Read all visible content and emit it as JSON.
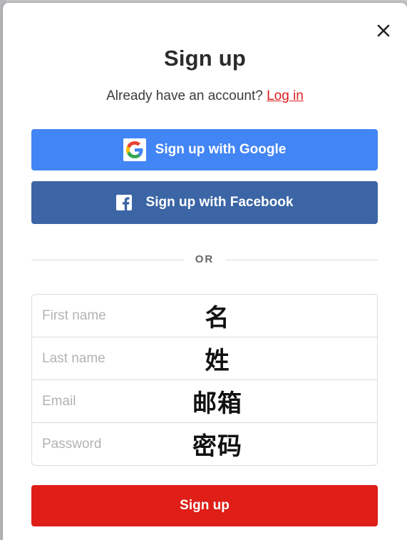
{
  "modal": {
    "title": "Sign up",
    "subtitle_prefix": "Already have an account?",
    "login_link": "Log in",
    "close_icon": "close-icon"
  },
  "social": {
    "google_label": "Sign up with Google",
    "google_icon": "google-g-icon",
    "google_color": "#4285f4",
    "facebook_label": "Sign up with Facebook",
    "facebook_icon": "facebook-f-icon",
    "facebook_color": "#3b65a5"
  },
  "divider": {
    "label": "OR"
  },
  "form": {
    "fields": [
      {
        "placeholder": "First name",
        "annotation": "名"
      },
      {
        "placeholder": "Last name",
        "annotation": "姓"
      },
      {
        "placeholder": "Email",
        "annotation": "邮箱"
      },
      {
        "placeholder": "Password",
        "annotation": "密码"
      }
    ]
  },
  "submit": {
    "label": "Sign up",
    "color": "#de1e17"
  }
}
